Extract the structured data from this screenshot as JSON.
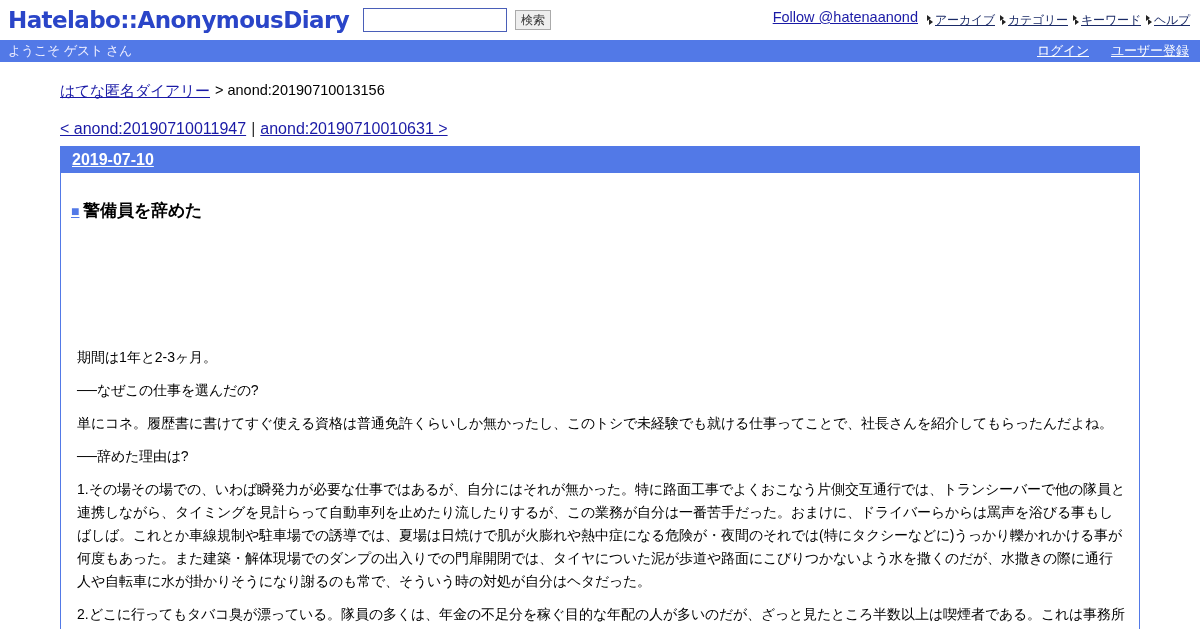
{
  "header": {
    "logo": "Hatelabo::AnonymousDiary",
    "search": {
      "button": "検索"
    },
    "follow": "Follow @hatenaanond",
    "menu": [
      "アーカイブ",
      "カテゴリー",
      "キーワード",
      "ヘルプ"
    ]
  },
  "user_bar": {
    "welcome": "ようこそ ゲスト さん",
    "links": [
      "ログイン",
      "ユーザー登録"
    ]
  },
  "breadcrumb": {
    "home": "はてな匿名ダイアリー",
    "current": "> anond:20190710013156"
  },
  "pager": {
    "prev": "< anond:20190710011947",
    "separator": "|",
    "next": "anond:20190710010631 >"
  },
  "entry": {
    "date": "2019-07-10",
    "title_mark": "■",
    "title": "警備員を辞めた",
    "paragraphs": [
      {
        "text": "期間は1年と2-3ヶ月。"
      },
      {
        "text": "──なぜこの仕事を選んだの?"
      },
      {
        "text": "単にコネ。履歴書に書けてすぐ使える資格は普通免許くらいしか無かったし、このトシで未経験でも就ける仕事ってことで、社長さんを紹介してもらったんだよね。"
      },
      {
        "text": "──辞めた理由は?"
      },
      {
        "text": "1.その場その場での、いわば瞬発力が必要な仕事ではあるが、自分にはそれが無かった。特に路面工事でよくおこなう片側交互通行では、トランシーバーで他の隊員と連携しながら、タイミングを見計らって自動車列を止めたり流したりするが、この業務が自分は一番苦手だった。おまけに、ドライバーらからは罵声を浴びる事もしばしば。これとか車線規制や駐車場での誘導では、夏場は日焼けで肌が火膨れや熱中症になる危険が・夜間のそれでは(特にタクシーなどに)うっかり轢かれかける事が何度もあった。また建築・解体現場でのダンプの出入りでの門扉開閉では、タイヤについた泥が歩道や路面にこびりつかないよう水を撒くのだが、水撒きの際に通行人や自転車に水が掛かりそうになり謝るのも常で、そういう時の対処が自分はヘタだった。"
      },
      {
        "text": "2.どこに行ってもタバコ臭が漂っている。隊員の多くは、年金の不足分を稼ぐ目的な年配の人が多いのだが、ざっと見たところ半数以上は喫煙者である。これは事務所"
      }
    ]
  }
}
